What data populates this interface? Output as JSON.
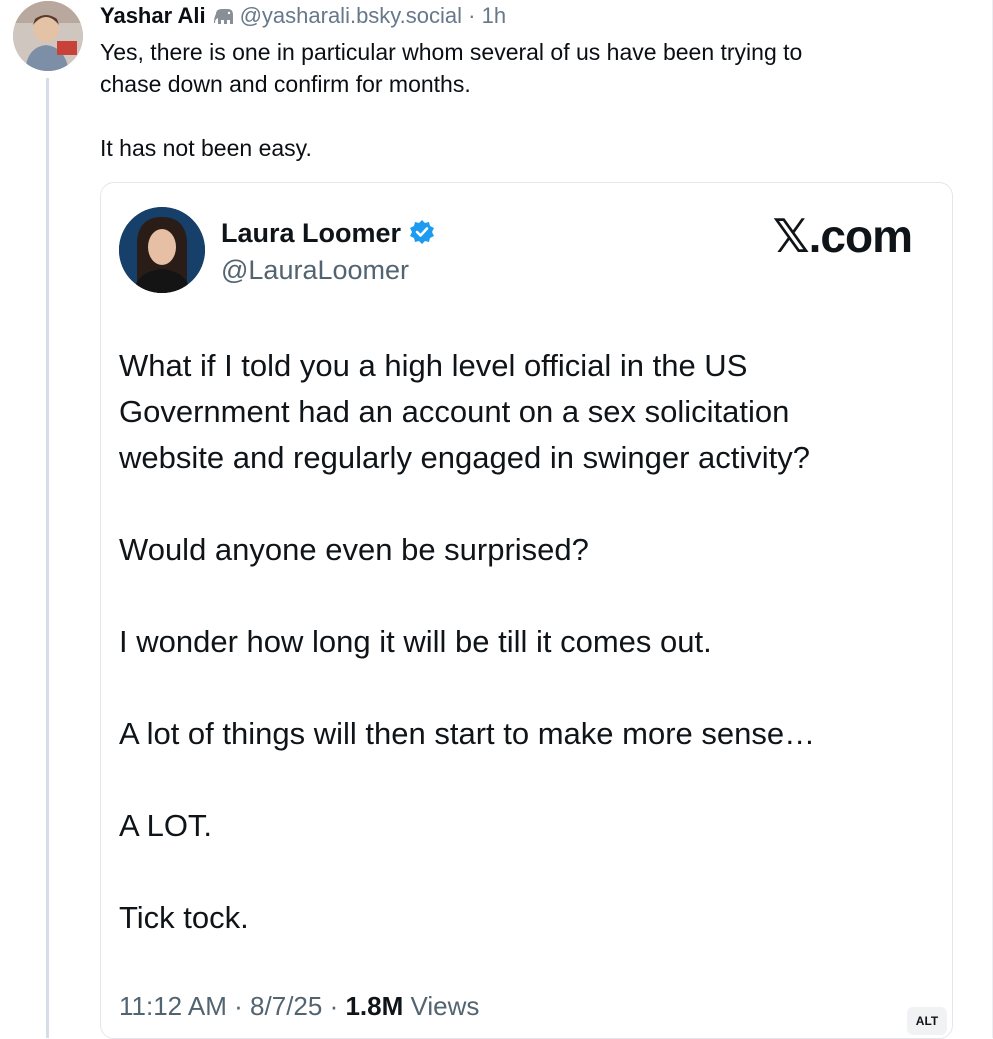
{
  "post": {
    "display_name": "Yashar Ali",
    "handle": "@yasharali.bsky.social",
    "separator": "·",
    "age": "1h",
    "text": "Yes, there is one in particular whom several of us have been trying to\nchase down and confirm for months.\n\nIt has not been easy.",
    "icons": {
      "avatar": "avatar-photo",
      "elephant": "elephant-icon"
    }
  },
  "embed": {
    "display_name": "Laura Loomer",
    "handle": "@LauraLoomer",
    "brand": "𝕏.com",
    "verified_icon": "verified-badge-icon",
    "paragraphs": [
      "What if I told you a high level official in the US\nGovernment had an account on a sex solicitation\nwebsite and regularly engaged in swinger activity?",
      "Would anyone even be surprised?",
      "I wonder how long it will be till it comes out.",
      "A lot of things will then start to make more sense…",
      "A LOT.",
      "Tick tock."
    ],
    "time": "11:12 AM",
    "date": "8/7/25",
    "views_count": "1.8M",
    "views_label": "Views",
    "alt_label": "ALT"
  },
  "colors": {
    "text": "#0b0f14",
    "muted": "#66788a",
    "thread_line": "#d6dde8",
    "verified_blue": "#1d9bf0",
    "border": "#e3e7ec"
  }
}
